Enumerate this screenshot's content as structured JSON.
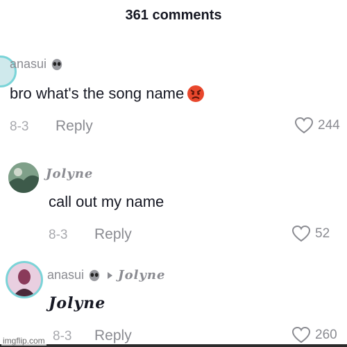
{
  "header": {
    "comments_count": "361 comments"
  },
  "comments": [
    {
      "username": "anasui",
      "text": "bro what's the song name",
      "date": "8-3",
      "reply_label": "Reply",
      "likes": "244"
    },
    {
      "username": "Jolyne",
      "text": "call out my name",
      "date": "8-3",
      "reply_label": "Reply",
      "likes": "52"
    },
    {
      "username": "anasui",
      "reply_to": "Jolyne",
      "text": "Jolyne",
      "date": "8-3",
      "reply_label": "Reply",
      "likes": "260"
    }
  ],
  "watermark": "imgflip.com",
  "icons": {
    "verified": "alien-icon",
    "reply_arrow": "arrow-icon",
    "like": "heart-outline-icon",
    "emoji": "angry-face-icon"
  },
  "colors": {
    "text": "#161823",
    "muted": "#8a8b91",
    "avatar_ring": "#7ad4d8"
  }
}
